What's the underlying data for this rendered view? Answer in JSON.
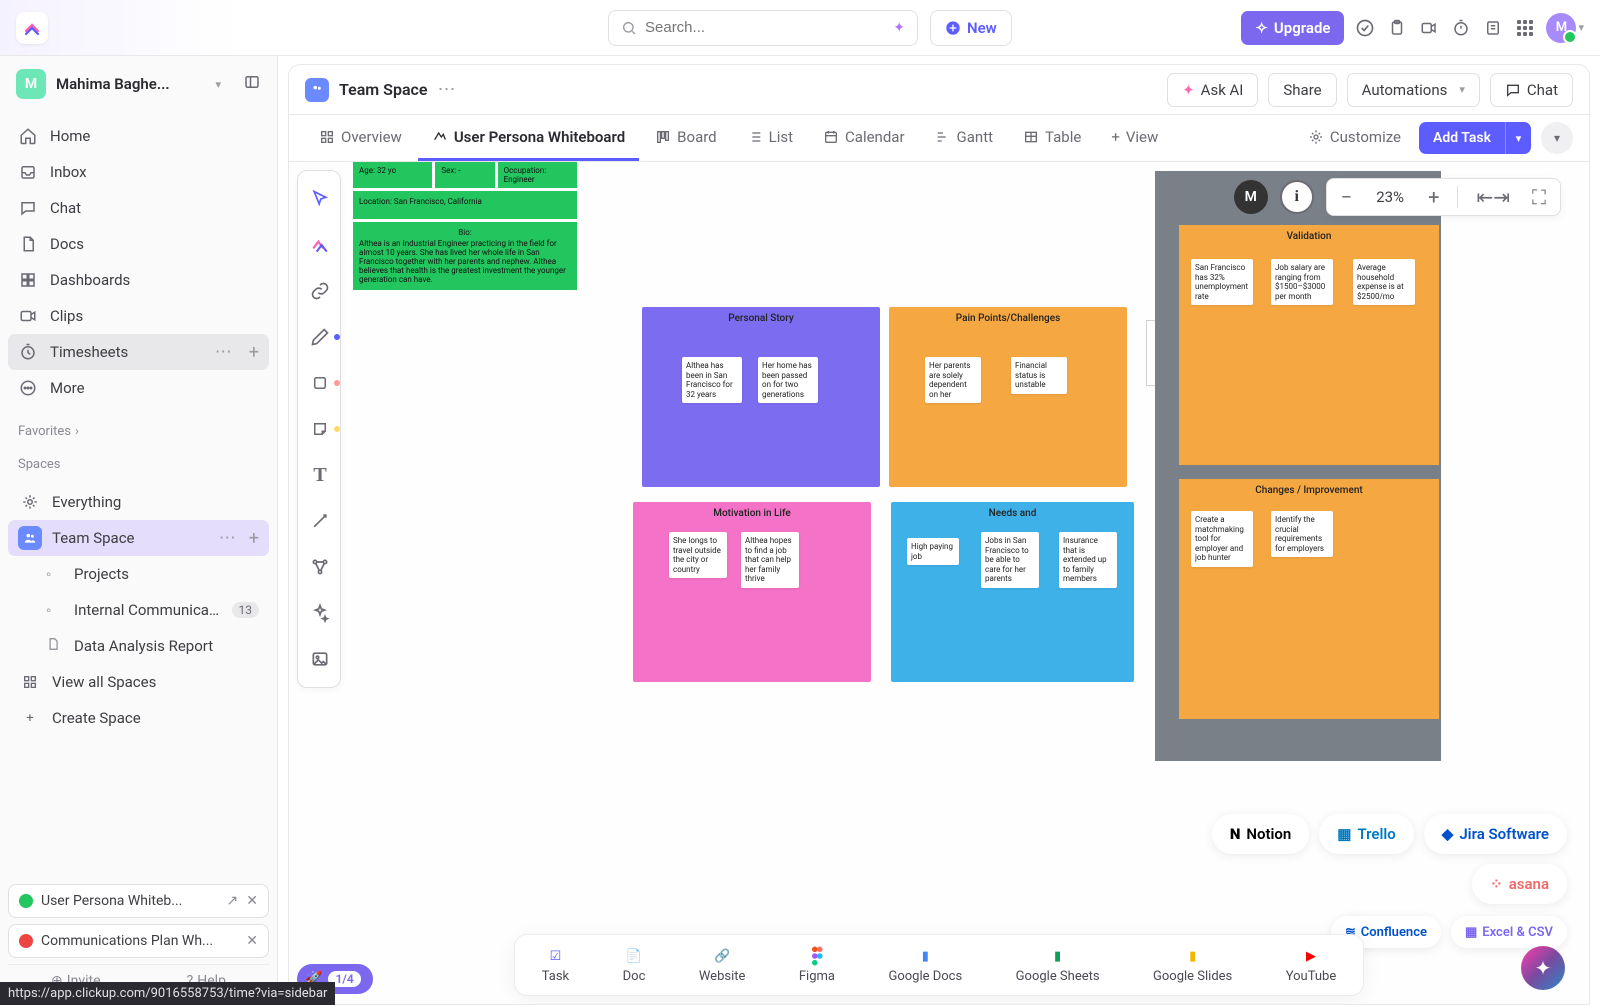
{
  "topbar": {
    "search_placeholder": "Search...",
    "new_label": "New",
    "upgrade_label": "Upgrade",
    "avatar_initial": "M"
  },
  "workspace": {
    "avatar_initial": "M",
    "name": "Mahima Baghe..."
  },
  "nav": [
    {
      "id": "home",
      "label": "Home"
    },
    {
      "id": "inbox",
      "label": "Inbox"
    },
    {
      "id": "chat",
      "label": "Chat"
    },
    {
      "id": "docs",
      "label": "Docs"
    },
    {
      "id": "dashboards",
      "label": "Dashboards"
    },
    {
      "id": "clips",
      "label": "Clips"
    },
    {
      "id": "timesheets",
      "label": "Timesheets"
    },
    {
      "id": "more",
      "label": "More"
    }
  ],
  "sections": {
    "favorites": "Favorites",
    "spaces": "Spaces"
  },
  "spaces": {
    "everything": "Everything",
    "team_space": "Team Space",
    "projects": "Projects",
    "internal_comm": "Internal Communicati...",
    "internal_comm_badge": "13",
    "data_report": "Data Analysis Report",
    "view_all": "View all Spaces",
    "create": "Create Space"
  },
  "open_tasks": [
    {
      "status": "green",
      "label": "User Persona Whiteb..."
    },
    {
      "status": "red",
      "label": "Communications Plan Wh..."
    }
  ],
  "bottom_links": {
    "invite": "Invite",
    "help": "Help"
  },
  "breadcrumb": {
    "title": "Team Space"
  },
  "header_actions": {
    "ask_ai": "Ask AI",
    "share": "Share",
    "automations": "Automations",
    "chat": "Chat"
  },
  "tabs": [
    {
      "id": "overview",
      "label": "Overview"
    },
    {
      "id": "whiteboard",
      "label": "User Persona Whiteboard",
      "active": true
    },
    {
      "id": "board",
      "label": "Board"
    },
    {
      "id": "list",
      "label": "List"
    },
    {
      "id": "calendar",
      "label": "Calendar"
    },
    {
      "id": "gantt",
      "label": "Gantt"
    },
    {
      "id": "table",
      "label": "Table"
    },
    {
      "id": "view",
      "label": "View"
    }
  ],
  "tabs_right": {
    "customize": "Customize",
    "add_task": "Add Task"
  },
  "zoom": {
    "percent": "23%",
    "avatar_initial": "M"
  },
  "whiteboard": {
    "profile": {
      "age": "Age: 32 yo",
      "sex": "Sex: -",
      "occupation": "Occupation: Engineer",
      "location": "Location: San Francisco, California",
      "bio_head": "Bio:",
      "bio": "Althea is an Industrial Engineer practicing in the field for almost 10 years. She has lived her whole life in San Francisco together with her parents and nephew. Althea believes that health is the greatest investment the younger generation can have."
    },
    "personal_story": {
      "title": "Personal Story",
      "cards": [
        "Althea has been in San Francisco for 32 years",
        "Her home has been passed on for two generations"
      ]
    },
    "pain_points": {
      "title": "Pain Points/Challenges",
      "cards": [
        "Her parents are solely dependent on her",
        "Financial status is unstable"
      ]
    },
    "motivation": {
      "title": "Motivation in Life",
      "cards": [
        "She longs to travel outside the city or country",
        "Althea hopes to find a job that can help her family thrive"
      ]
    },
    "needs": {
      "title": "Needs and",
      "cards": [
        "High paying job",
        "Jobs in San Francisco to be able to care for her parents",
        "Insurance that is extended up to family members"
      ]
    },
    "validation": {
      "title": "Validation",
      "cards": [
        "San Francisco has 32% unemployment rate",
        "Job salary are ranging from $1500–$3000 per month",
        "Average household expense is at $2500/mo"
      ]
    },
    "changes": {
      "title": "Changes / Improvement",
      "cards": [
        "Create a matchmaking tool for employer and job hunter",
        "Identify the crucial requirements for employers"
      ]
    }
  },
  "integrations": {
    "row1": [
      "Notion",
      "Trello",
      "Jira Software",
      "asana"
    ],
    "row2": [
      "Confluence",
      "Excel & CSV"
    ]
  },
  "dock": [
    "Task",
    "Doc",
    "Website",
    "Figma",
    "Google Docs",
    "Google Sheets",
    "Google Slides",
    "YouTube"
  ],
  "progress": "1/4",
  "url_tip": "https://app.clickup.com/9016558753/time?via=sidebar"
}
